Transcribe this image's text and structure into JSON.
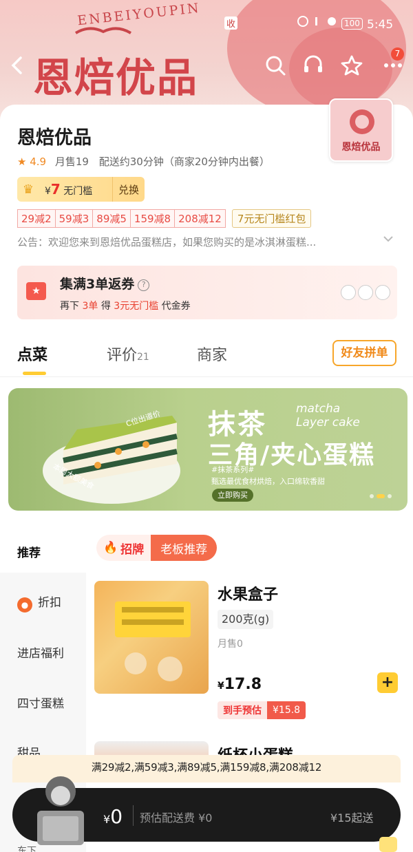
{
  "status_bar": {
    "time": "5:45",
    "battery": "100",
    "carrier_badge": "收"
  },
  "banner": {
    "arc_text": "ENBEIYOUPIN",
    "big_title": "恩焙优品",
    "sub_text": "恩焙优品"
  },
  "top_icons": [
    "back-icon",
    "search-icon",
    "customer-service-icon",
    "favorite-icon",
    "more-icon"
  ],
  "more_badge": "7",
  "store": {
    "name": "恩焙优品",
    "logo_text": "恩焙优品",
    "rating": "4.9",
    "monthly_sales": "月售19",
    "delivery": "配送约30分钟（商家20分钟内出餐）"
  },
  "vip": {
    "currency": "¥",
    "amount": "7",
    "label": "无门槛",
    "exchange": "兑换"
  },
  "discount_tags": [
    "29减2",
    "59减3",
    "89减5",
    "159减8",
    "208减12"
  ],
  "red_packet_tag": "7元无门槛红包",
  "notice": "公告：欢迎您来到恩焙优品蛋糕店，如果您购买的是冰淇淋蛋糕...",
  "coupon": {
    "title": "集满3单返券",
    "help": "?",
    "line_pre": "再下",
    "line_orders": "3单",
    "line_mid": "得",
    "line_value": "3元无门槛",
    "line_post": "代金券"
  },
  "tabs": {
    "order": "点菜",
    "reviews": "评价",
    "reviews_count": "21",
    "merchant": "商家",
    "friends": "好友拼单"
  },
  "promo": {
    "title_1": "抹茶",
    "title_en_1": "matcha",
    "title_en_2": "Layer cake",
    "title_2": "三角/夹心蛋糕",
    "series": "#抹茶系列#",
    "desc": "甄选最优食材烘焙，入口绵软香甜",
    "buy": "立即购买",
    "caption_1": "C位出道价",
    "caption_2": "本周大额美食"
  },
  "menu": {
    "recommend": "推荐",
    "sign_tag_a": "招牌",
    "sign_tag_b": "老板推荐",
    "side_items": [
      "折扣",
      "进店福利",
      "四寸蛋糕",
      "甜品"
    ],
    "side_peek": "东下"
  },
  "product_1": {
    "name": "水果盒子",
    "spec": "200克(g)",
    "sold": "月售0",
    "currency": "¥",
    "price": "17.8",
    "est_label": "到手预估",
    "est_price": "¥15.8",
    "add": "+"
  },
  "product_2": {
    "name": "纸杯小蛋糕"
  },
  "promo_strip": "满29减2,满59减3,满89减5,满159减8,满208减12",
  "cart": {
    "currency": "¥",
    "total": "0",
    "delivery_fee": "预估配送费 ¥0",
    "min_order": "¥15起送"
  }
}
